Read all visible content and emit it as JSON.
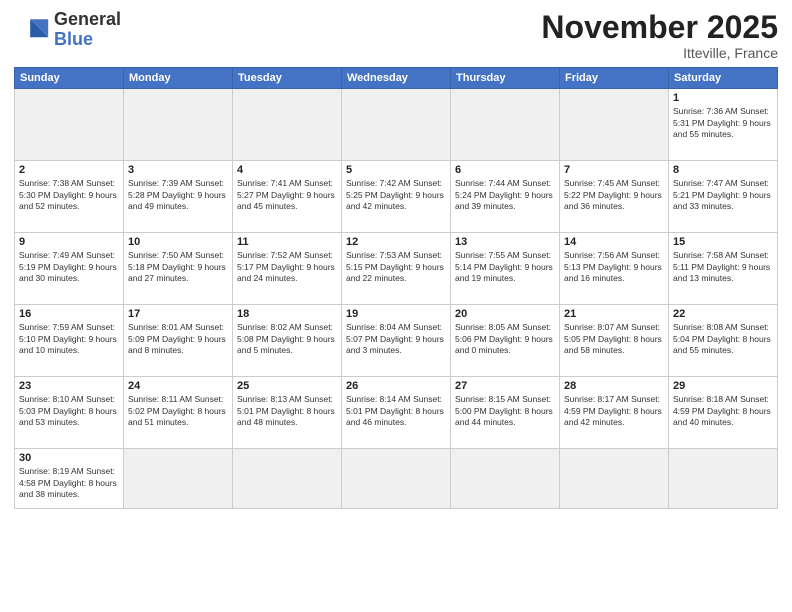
{
  "header": {
    "logo_general": "General",
    "logo_blue": "Blue",
    "month_title": "November 2025",
    "location": "Itteville, France"
  },
  "weekdays": [
    "Sunday",
    "Monday",
    "Tuesday",
    "Wednesday",
    "Thursday",
    "Friday",
    "Saturday"
  ],
  "weeks": [
    [
      {
        "day": "",
        "info": "",
        "empty": true
      },
      {
        "day": "",
        "info": "",
        "empty": true
      },
      {
        "day": "",
        "info": "",
        "empty": true
      },
      {
        "day": "",
        "info": "",
        "empty": true
      },
      {
        "day": "",
        "info": "",
        "empty": true
      },
      {
        "day": "",
        "info": "",
        "empty": true
      },
      {
        "day": "1",
        "info": "Sunrise: 7:36 AM\nSunset: 5:31 PM\nDaylight: 9 hours\nand 55 minutes."
      }
    ],
    [
      {
        "day": "2",
        "info": "Sunrise: 7:38 AM\nSunset: 5:30 PM\nDaylight: 9 hours\nand 52 minutes."
      },
      {
        "day": "3",
        "info": "Sunrise: 7:39 AM\nSunset: 5:28 PM\nDaylight: 9 hours\nand 49 minutes."
      },
      {
        "day": "4",
        "info": "Sunrise: 7:41 AM\nSunset: 5:27 PM\nDaylight: 9 hours\nand 45 minutes."
      },
      {
        "day": "5",
        "info": "Sunrise: 7:42 AM\nSunset: 5:25 PM\nDaylight: 9 hours\nand 42 minutes."
      },
      {
        "day": "6",
        "info": "Sunrise: 7:44 AM\nSunset: 5:24 PM\nDaylight: 9 hours\nand 39 minutes."
      },
      {
        "day": "7",
        "info": "Sunrise: 7:45 AM\nSunset: 5:22 PM\nDaylight: 9 hours\nand 36 minutes."
      },
      {
        "day": "8",
        "info": "Sunrise: 7:47 AM\nSunset: 5:21 PM\nDaylight: 9 hours\nand 33 minutes."
      }
    ],
    [
      {
        "day": "9",
        "info": "Sunrise: 7:49 AM\nSunset: 5:19 PM\nDaylight: 9 hours\nand 30 minutes."
      },
      {
        "day": "10",
        "info": "Sunrise: 7:50 AM\nSunset: 5:18 PM\nDaylight: 9 hours\nand 27 minutes."
      },
      {
        "day": "11",
        "info": "Sunrise: 7:52 AM\nSunset: 5:17 PM\nDaylight: 9 hours\nand 24 minutes."
      },
      {
        "day": "12",
        "info": "Sunrise: 7:53 AM\nSunset: 5:15 PM\nDaylight: 9 hours\nand 22 minutes."
      },
      {
        "day": "13",
        "info": "Sunrise: 7:55 AM\nSunset: 5:14 PM\nDaylight: 9 hours\nand 19 minutes."
      },
      {
        "day": "14",
        "info": "Sunrise: 7:56 AM\nSunset: 5:13 PM\nDaylight: 9 hours\nand 16 minutes."
      },
      {
        "day": "15",
        "info": "Sunrise: 7:58 AM\nSunset: 5:11 PM\nDaylight: 9 hours\nand 13 minutes."
      }
    ],
    [
      {
        "day": "16",
        "info": "Sunrise: 7:59 AM\nSunset: 5:10 PM\nDaylight: 9 hours\nand 10 minutes."
      },
      {
        "day": "17",
        "info": "Sunrise: 8:01 AM\nSunset: 5:09 PM\nDaylight: 9 hours\nand 8 minutes."
      },
      {
        "day": "18",
        "info": "Sunrise: 8:02 AM\nSunset: 5:08 PM\nDaylight: 9 hours\nand 5 minutes."
      },
      {
        "day": "19",
        "info": "Sunrise: 8:04 AM\nSunset: 5:07 PM\nDaylight: 9 hours\nand 3 minutes."
      },
      {
        "day": "20",
        "info": "Sunrise: 8:05 AM\nSunset: 5:06 PM\nDaylight: 9 hours\nand 0 minutes."
      },
      {
        "day": "21",
        "info": "Sunrise: 8:07 AM\nSunset: 5:05 PM\nDaylight: 8 hours\nand 58 minutes."
      },
      {
        "day": "22",
        "info": "Sunrise: 8:08 AM\nSunset: 5:04 PM\nDaylight: 8 hours\nand 55 minutes."
      }
    ],
    [
      {
        "day": "23",
        "info": "Sunrise: 8:10 AM\nSunset: 5:03 PM\nDaylight: 8 hours\nand 53 minutes."
      },
      {
        "day": "24",
        "info": "Sunrise: 8:11 AM\nSunset: 5:02 PM\nDaylight: 8 hours\nand 51 minutes."
      },
      {
        "day": "25",
        "info": "Sunrise: 8:13 AM\nSunset: 5:01 PM\nDaylight: 8 hours\nand 48 minutes."
      },
      {
        "day": "26",
        "info": "Sunrise: 8:14 AM\nSunset: 5:01 PM\nDaylight: 8 hours\nand 46 minutes."
      },
      {
        "day": "27",
        "info": "Sunrise: 8:15 AM\nSunset: 5:00 PM\nDaylight: 8 hours\nand 44 minutes."
      },
      {
        "day": "28",
        "info": "Sunrise: 8:17 AM\nSunset: 4:59 PM\nDaylight: 8 hours\nand 42 minutes."
      },
      {
        "day": "29",
        "info": "Sunrise: 8:18 AM\nSunset: 4:59 PM\nDaylight: 8 hours\nand 40 minutes."
      }
    ],
    [
      {
        "day": "30",
        "info": "Sunrise: 8:19 AM\nSunset: 4:58 PM\nDaylight: 8 hours\nand 38 minutes.",
        "last": true
      },
      {
        "day": "",
        "info": "",
        "empty": true,
        "last": true
      },
      {
        "day": "",
        "info": "",
        "empty": true,
        "last": true
      },
      {
        "day": "",
        "info": "",
        "empty": true,
        "last": true
      },
      {
        "day": "",
        "info": "",
        "empty": true,
        "last": true
      },
      {
        "day": "",
        "info": "",
        "empty": true,
        "last": true
      },
      {
        "day": "",
        "info": "",
        "empty": true,
        "last": true
      }
    ]
  ]
}
